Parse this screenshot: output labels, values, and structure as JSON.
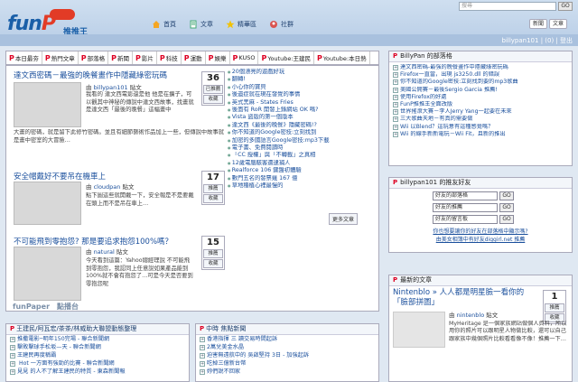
{
  "logo": {
    "text_a": "fun",
    "text_b": "P",
    "chinese": "推推王"
  },
  "mainnav": [
    {
      "label": "首頁",
      "icon": "home-icon"
    },
    {
      "label": "文章",
      "icon": "article-icon"
    },
    {
      "label": "精華區",
      "icon": "star-icon"
    },
    {
      "label": "社群",
      "icon": "group-icon"
    }
  ],
  "search": {
    "placeholder": "搜尋",
    "button": "GO"
  },
  "addbuttons": [
    "新聞",
    "文章"
  ],
  "user": {
    "text": "billypan101 | (0) | 登出"
  },
  "categories": [
    "本日最夯",
    "熱門文章",
    "部落格",
    "新聞",
    "影片",
    "科技",
    "運動",
    "娛樂",
    "KUSO",
    "Youtube:王建民",
    "Youtube:本日熱"
  ],
  "articles": [
    {
      "title": "達文西密碼－最強的晚餐畫作中隱藏綠密玩碼",
      "votes": "36",
      "btn1": "已推薦",
      "btn2": "收藏",
      "author_prefix": "由",
      "author": "billypan101",
      "author_suffix": "貼文",
      "body1": "我看的 達文西電影還是他 他是在擴子，可以觀其中神秘的傳說中達文西故事，找畫就是達文西「最後的晚餐」這幅畫中",
      "body2": "的所有結構做的偽裝地方，所以說的人物就是在畫的世紀之前，藏在晚餐中的密碼人數。晚餐裡所有的佈置都被設計成隱藏的玩碼，而且說達文西很喜歡",
      "body3": "大畫的密碼，就是留下此修竹密碼。並且有細節藝術作品加上一些，但傳說中故事就是畫中密室的大冒險…"
    },
    {
      "title": "安全帽戴好不要吊在機車上",
      "votes": "17",
      "btn1": "推薦",
      "btn2": "收藏",
      "author_prefix": "由",
      "author": "cloudpan",
      "author_suffix": "貼文",
      "body1": "點下圖這些就開戴一下，安全帽是不是要戴在頭上而不是吊在車上…"
    },
    {
      "title": "不可能飛到零抱怨? 那是要追求抱怨100%嗎？",
      "votes": "15",
      "btn1": "推薦",
      "btn2": "收藏",
      "author_prefix": "由",
      "author": "natural",
      "author_suffix": "貼文",
      "body1": "今天看到這篇：Yahoo總經理說 不可能飛到零抱怨，我認同上任意說如果產品能到100%就不會有抱怨了…可是今天是否要到零抱怨呢"
    }
  ],
  "midlist": [
    "20個漂亮的遊戲好玩",
    "翻轉!",
    "小心你的寶貝",
    "後遺症就在現在發覺的事情",
    "英式黑麻 - States Fries",
    "後面有 RoR 開發上錄網站 OK 嗎?",
    "Vista 盜版的第一個版本 ",
    "達文西《最後的晚餐》隱藏密碼!?",
    "你不知道的Google密技:立刻找到",
    "加密的多國語言Google密技:mp3下載",
    "電子書、免費閱讀時",
    "「CC 授權」與「不轉載」之真相",
    "12歲電腦駭客遭逮捕人",
    "Realforce 106 鍵盤初體驗",
    "數門五名的發票幾 167 億",
    "草地種植心裡最慢的"
  ],
  "morebtn": "更多文章",
  "funpaper": "funPaper　點播台",
  "blogbox": {
    "title": "BillyPan 的部落格",
    "items": [
      "達文西密碼-最強的晚餐畫作中隱藏綠密玩碼",
      "Firefox一直當，出現 js3250.dll 的錯誤",
      "你不知道的Google密技:立刻找到要的mp3歌曲",
      "美國公開賽－最後Sergio Garcia 推薦!",
      "使用Firefox的好處",
      "FunP推推王全面改版",
      "世界搖滾大賽－李人Jerry Yang一起要在未來",
      "三大歌曲天地－有真的需要做",
      "Wii 以Blend？這玩意有這種感覺嗎？",
      "Wii 的線手新新電玩－Wii Fit，且新的推出"
    ]
  },
  "friendbox": {
    "title": "billypan101 的推友好友",
    "sel1": "好友的部落格",
    "sel2": "好友的推薦",
    "sel3": "好友的留言板",
    "go": "GO",
    "link1": "你也想要讓你的好友在部落格中顯示嗎?",
    "link2": "由美女相簿中有好友diggirl.net 推薦"
  },
  "latest": {
    "title": "最新的文章",
    "headline": "Nintenblo » 人人都是明星臉一看你的「臉部拼圖」",
    "votes": "1",
    "btn1": "推薦",
    "btn2": "收藏",
    "author_prefix": "由",
    "author": "nintenblo",
    "author_suffix": "貼文",
    "body": "MyHeritage 是一個家族網站做個人資料，所以用你的照片可以跟明星人物做比較，還可以自己跟家族中幾個照片比較看看像不像！推薦一下…"
  },
  "boxA": {
    "title": "王建民/阿瓦宏/茶茶/林威助大聯盟動態整理",
    "items": [
      "推撒電影─明年150完場 - 聯合新聞網",
      "擊敗擊球手松坂—天 - 聯合新聞網",
      "王建民再度稱霸",
      " Hot 一方面有強勁的比賽 - 聯合新聞網",
      "見見 的人不了解王建民的特質 - 東森新聞報"
    ]
  },
  "boxB": {
    "title": "中時 焦點新聞",
    "items": [
      "香港指揮 三 讀交易時間起訴",
      "2萬兌美金水晶",
      "迫害無遠航中的 吳啟堅持 3日 - 加強起訴",
      "吃掉三億新台幣",
      "妳們說不回家"
    ]
  }
}
